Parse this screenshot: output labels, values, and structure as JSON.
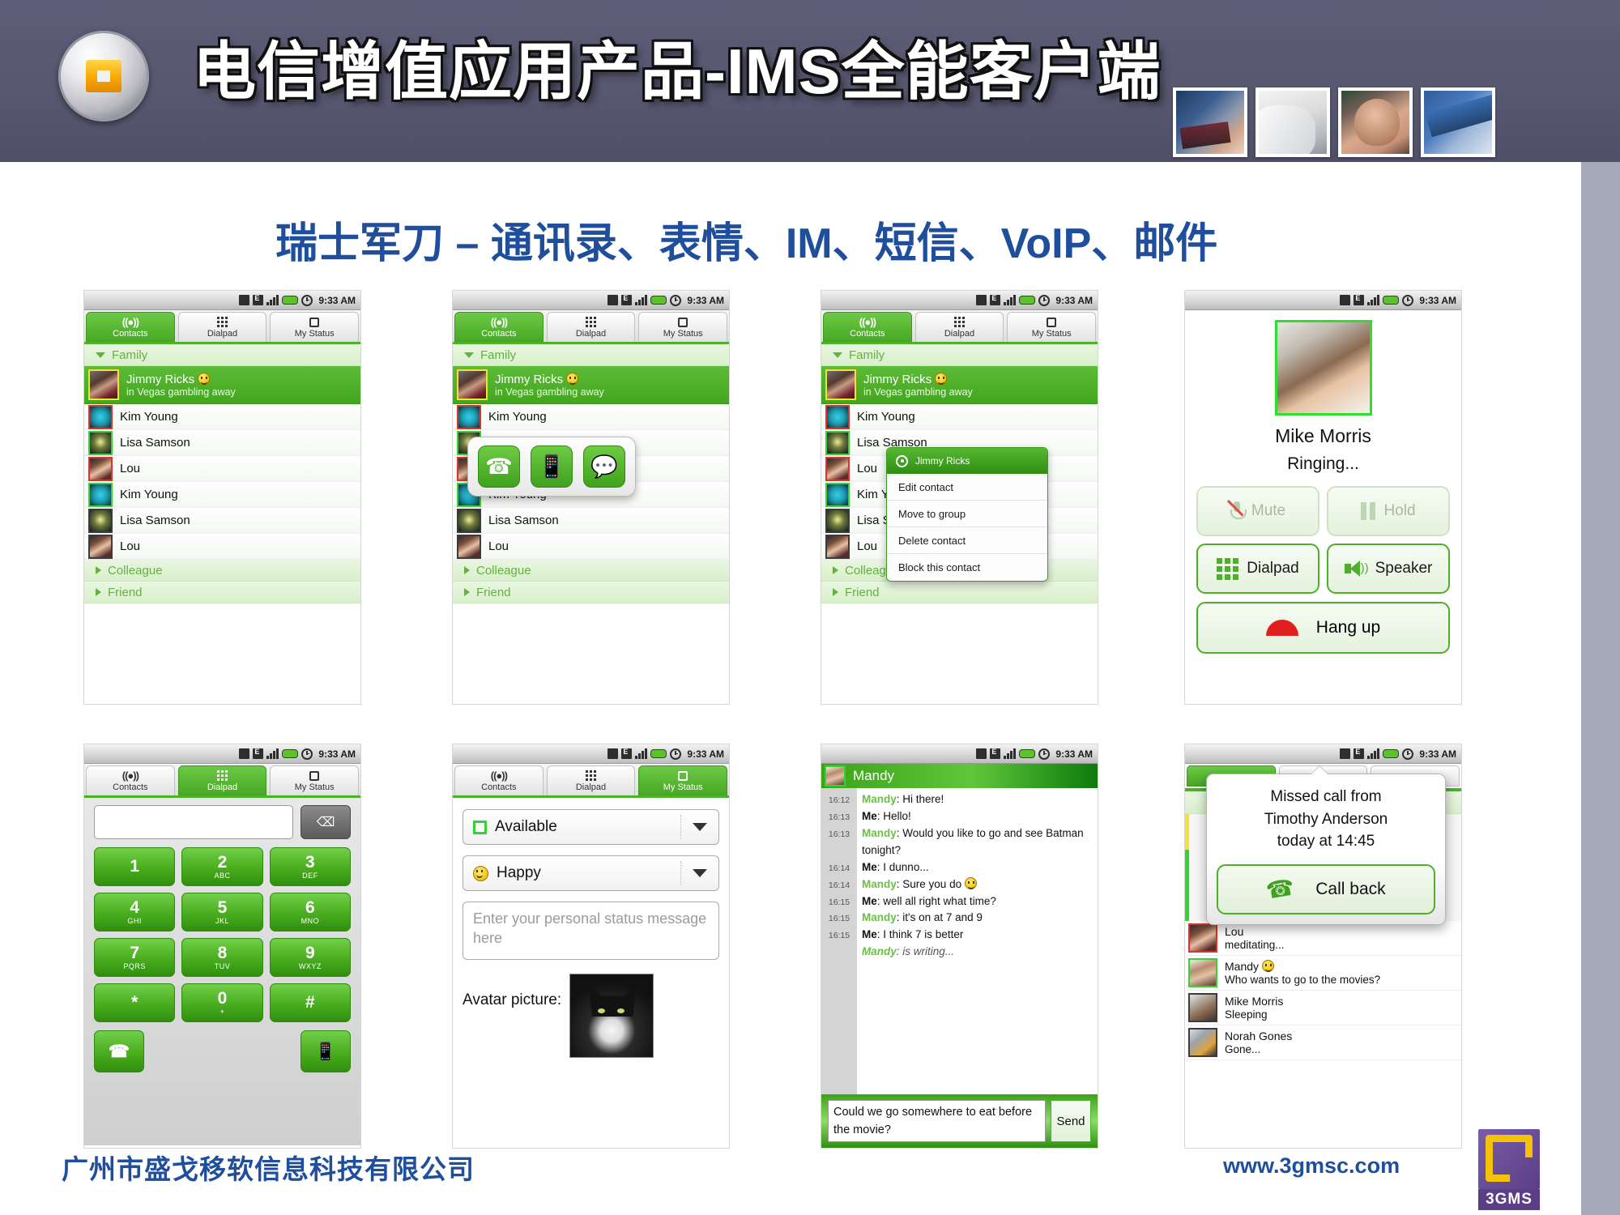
{
  "header": {
    "title": "电信增值应用产品-IMS全能客户端",
    "logo_icon": "square-badge-logo",
    "photos": [
      "photo-handheld-device",
      "photo-headset",
      "photo-businessman",
      "photo-desk-phone"
    ]
  },
  "subtitle": "瑞士军刀 – 通讯录、表情、IM、短信、VoIP、邮件",
  "statusbar": {
    "time": "9:33 AM",
    "icons": [
      "sync-icon",
      "edge-icon",
      "signal-icon",
      "battery-icon",
      "alarm-icon"
    ]
  },
  "tabs": {
    "contacts": "Contacts",
    "dialpad": "Dialpad",
    "my_status": "My Status"
  },
  "groups": {
    "family": "Family",
    "colleague": "Colleague",
    "friend": "Friend"
  },
  "contacts_screen": {
    "selected": {
      "name": "Jimmy Ricks",
      "status": "in Vegas gambling away",
      "mood_icon": "smiley-icon"
    },
    "list": [
      {
        "name": "Kim Young",
        "avatar": "butterfly",
        "ring": "red"
      },
      {
        "name": "Lisa Samson",
        "avatar": "star",
        "ring": "green"
      },
      {
        "name": "Lou",
        "avatar": "girl",
        "ring": "red"
      },
      {
        "name": "Kim Young",
        "avatar": "butterfly",
        "ring": "green"
      },
      {
        "name": "Lisa Samson",
        "avatar": "star",
        "ring": "dark"
      },
      {
        "name": "Lou",
        "avatar": "girl",
        "ring": "dark"
      }
    ]
  },
  "action_popup": {
    "icons": [
      "phone-call-icon",
      "sms-icon",
      "chat-bubble-icon"
    ]
  },
  "context_menu": {
    "title": "Jimmy Ricks",
    "items": [
      "Edit contact",
      "Move to group",
      "Delete contact",
      "Block this contact"
    ]
  },
  "call_screen": {
    "name": "Mike Morris",
    "state": "Ringing...",
    "buttons": [
      {
        "label": "Mute",
        "icon": "mic-muted-icon",
        "enabled": false
      },
      {
        "label": "Hold",
        "icon": "pause-icon",
        "enabled": false
      },
      {
        "label": "Dialpad",
        "icon": "keypad-icon",
        "enabled": true
      },
      {
        "label": "Speaker",
        "icon": "speaker-icon",
        "enabled": true
      }
    ],
    "hangup": "Hang up"
  },
  "dialpad_screen": {
    "input_value": "",
    "delete_icon": "backspace-icon",
    "keys": [
      {
        "digit": "1",
        "letters": ""
      },
      {
        "digit": "2",
        "letters": "ABC"
      },
      {
        "digit": "3",
        "letters": "DEF"
      },
      {
        "digit": "4",
        "letters": "GHI"
      },
      {
        "digit": "5",
        "letters": "JKL"
      },
      {
        "digit": "6",
        "letters": "MNO"
      },
      {
        "digit": "7",
        "letters": "PQRS"
      },
      {
        "digit": "8",
        "letters": "TUV"
      },
      {
        "digit": "9",
        "letters": "WXYZ"
      },
      {
        "digit": "*",
        "letters": ""
      },
      {
        "digit": "0",
        "letters": "+"
      },
      {
        "digit": "#",
        "letters": ""
      }
    ],
    "call_icon": "phone-call-icon",
    "sms_icon": "sms-icon"
  },
  "status_screen": {
    "availability": "Available",
    "mood": "Happy",
    "message_placeholder": "Enter your personal status message here",
    "avatar_label": "Avatar picture:",
    "avatar_image": "black-cat-photo"
  },
  "chat_screen": {
    "contact": "Mandy",
    "messages": [
      {
        "time": "16:12",
        "who": "Mandy",
        "text": "Hi there!"
      },
      {
        "time": "16:13",
        "who": "Me",
        "text": "Hello!"
      },
      {
        "time": "16:13",
        "who": "Mandy",
        "text": "Would you like to go and see Batman tonight?"
      },
      {
        "time": "16:14",
        "who": "Me",
        "text": "I dunno..."
      },
      {
        "time": "16:14",
        "who": "Mandy",
        "text": "Sure you do",
        "emoji": "wink-smiley-icon"
      },
      {
        "time": "16:15",
        "who": "Me",
        "text": "well all right what time?"
      },
      {
        "time": "16:15",
        "who": "Mandy",
        "text": "it's on at 7 and 9"
      },
      {
        "time": "16:15",
        "who": "Me",
        "text": "I think 7 is better"
      },
      {
        "time": "",
        "who": "Mandy",
        "text": "is writing..."
      }
    ],
    "input_value": "Could we go somewhere to eat before the movie?",
    "send_label": "Send"
  },
  "missed_call_screen": {
    "popup_lines": [
      "Missed call from",
      "Timothy Anderson",
      "today at 14:45"
    ],
    "callback_label": "Call back",
    "callback_icon": "phone-call-icon",
    "behind_list": [
      {
        "name": "Lou",
        "status": "meditating...",
        "avatar": "girl",
        "ring": "red"
      },
      {
        "name": "Mandy",
        "status": "Who wants to go to the movies?",
        "avatar": "mandy",
        "ring": "green",
        "mood_icon": "smiley-icon"
      },
      {
        "name": "Mike Morris",
        "status": "Sleeping",
        "avatar": "mike",
        "ring": "dark"
      },
      {
        "name": "Norah Gones",
        "status": "Gone...",
        "avatar": "norah",
        "ring": "dark"
      }
    ]
  },
  "footer": {
    "company": "广州市盛戈移软信息科技有限公司",
    "website": "www.3gmsc.com",
    "logo_text": "3GMS"
  },
  "colors": {
    "header_bg": "#55556e",
    "brand_blue": "#1f4e9c",
    "android_green": "#4cb02a",
    "right_strip": "#a6aab8"
  }
}
